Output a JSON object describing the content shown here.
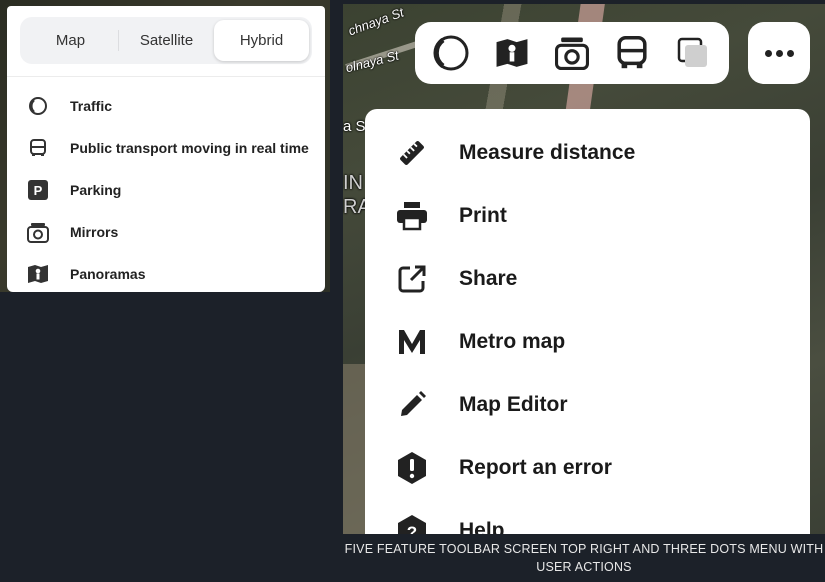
{
  "layers_panel": {
    "tabs": [
      {
        "label": "Map",
        "active": false
      },
      {
        "label": "Satellite",
        "active": false
      },
      {
        "label": "Hybrid",
        "active": true
      }
    ],
    "items": [
      {
        "label": "Traffic",
        "icon": "traffic-icon"
      },
      {
        "label": "Public transport moving in real time",
        "icon": "bus-icon"
      },
      {
        "label": "Parking",
        "icon": "parking-icon"
      },
      {
        "label": "Mirrors",
        "icon": "camera-icon"
      },
      {
        "label": "Panoramas",
        "icon": "panorama-icon"
      }
    ]
  },
  "map": {
    "street_labels": [
      "chnaya St",
      "olnaya St",
      "a S",
      "IN",
      "RA"
    ]
  },
  "toolbar": {
    "buttons": [
      "traffic-icon",
      "panorama-icon",
      "camera-icon",
      "bus-icon",
      "layers-icon"
    ],
    "more_icon": "more-dots-icon"
  },
  "menu": {
    "items": [
      {
        "label": "Measure distance",
        "icon": "ruler-icon"
      },
      {
        "label": "Print",
        "icon": "printer-icon"
      },
      {
        "label": "Share",
        "icon": "share-icon"
      },
      {
        "label": "Metro map",
        "icon": "metro-icon"
      },
      {
        "label": "Map Editor",
        "icon": "pencil-icon"
      },
      {
        "label": "Report an error",
        "icon": "error-icon"
      },
      {
        "label": "Help",
        "icon": "help-icon"
      }
    ]
  },
  "caption": "FIVE FEATURE TOOLBAR SCREEN TOP RIGHT AND THREE DOTS MENU WITH USER ACTIONS"
}
